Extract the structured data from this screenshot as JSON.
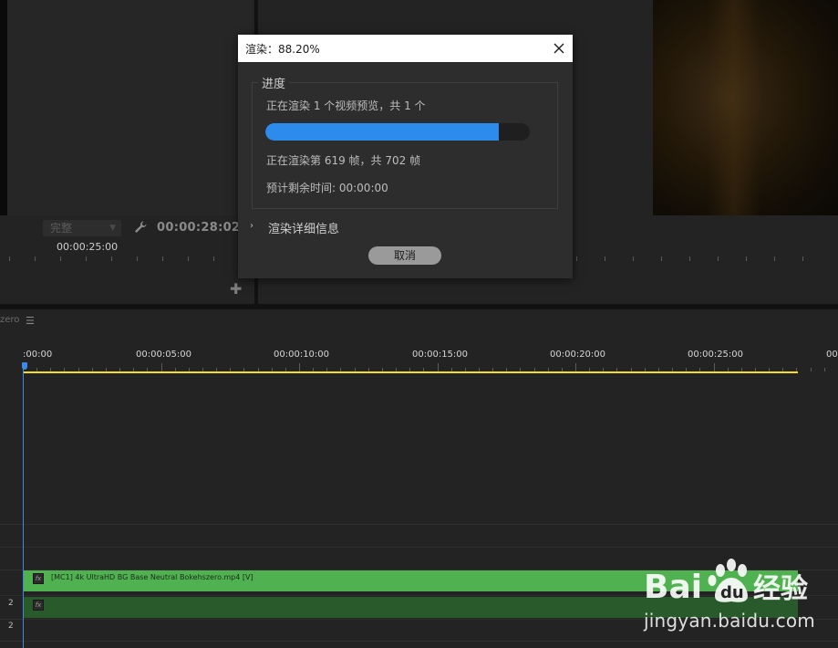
{
  "source_monitor": {
    "quality": "完整",
    "timecode": "00:00:28:02",
    "ruler_label": "00:00:25:00"
  },
  "timeline": {
    "sequence_tab_suffix": "zero",
    "ruler_labels": [
      ":00:00",
      "00:00:05:00",
      "00:00:10:00",
      "00:00:15:00",
      "00:00:20:00",
      "00:00:25:00",
      "00"
    ],
    "track_numbers": [
      "2",
      "2"
    ],
    "video_clip_label": "[MC1] 4k UltraHD BG Base Neutral Bokehszero.mp4 [V]",
    "colors": {
      "playhead": "#3b89e8",
      "work_area": "#f2de1a",
      "video_clip": "#4fb14f",
      "audio_clip": "#285a2c"
    }
  },
  "dialog": {
    "title": "渲染：88.20%",
    "group_label": "进度",
    "line1": "正在渲染 1 个视频预览，共 1 个",
    "progress_fraction": 0.882,
    "line2": "正在渲染第 619 帧，共 702 帧",
    "line3": "预计剩余时间: 00:00:00",
    "details_label": "渲染详细信息",
    "cancel_label": "取消",
    "accent": "#2d8ceb"
  },
  "watermark": {
    "brand_text": "经验",
    "url": "jingyan.baidu.com"
  }
}
